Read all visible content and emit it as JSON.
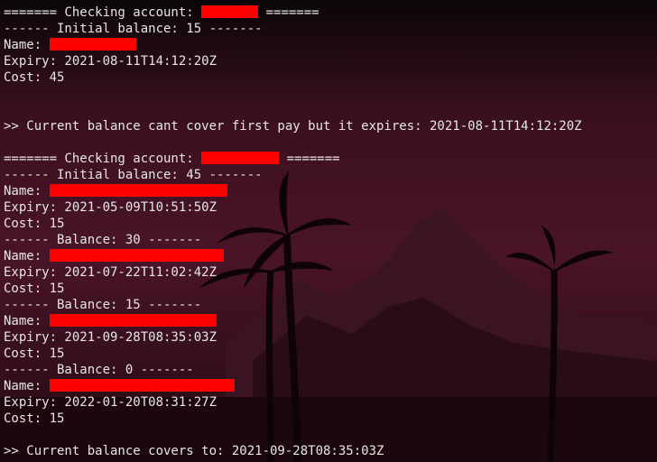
{
  "terminal": {
    "lines": [
      {
        "pre": "======= Checking account: ",
        "redact": "r-acc1",
        "post": " ======="
      },
      {
        "text": "------ Initial balance: 15 -------"
      },
      {
        "pre": "Name: ",
        "redact": "r-name1",
        "post": ""
      },
      {
        "text": "Expiry: 2021-08-11T14:12:20Z"
      },
      {
        "text": "Cost: 45"
      },
      {
        "blank": true
      },
      {
        "blank": true
      },
      {
        "text": ">> Current balance cant cover first pay but it expires: 2021-08-11T14:12:20Z"
      },
      {
        "blank": true
      },
      {
        "pre": "======= Checking account: ",
        "redact": "r-acc2",
        "post": " ======="
      },
      {
        "text": "------ Initial balance: 45 -------"
      },
      {
        "pre": "Name: ",
        "redact": "r-name2",
        "post": ""
      },
      {
        "text": "Expiry: 2021-05-09T10:51:50Z"
      },
      {
        "text": "Cost: 15"
      },
      {
        "text": "------ Balance: 30 -------"
      },
      {
        "pre": "Name: ",
        "redact": "r-name3",
        "post": ""
      },
      {
        "text": "Expiry: 2021-07-22T11:02:42Z"
      },
      {
        "text": "Cost: 15"
      },
      {
        "text": "------ Balance: 15 -------"
      },
      {
        "pre": "Name: ",
        "redact": "r-name4",
        "post": ""
      },
      {
        "text": "Expiry: 2021-09-28T08:35:03Z"
      },
      {
        "text": "Cost: 15"
      },
      {
        "text": "------ Balance: 0 -------"
      },
      {
        "pre": "Name: ",
        "redact": "r-name5",
        "post": ""
      },
      {
        "text": "Expiry: 2022-01-20T08:31:27Z"
      },
      {
        "text": "Cost: 15"
      },
      {
        "blank": true
      },
      {
        "text": ">> Current balance covers to: 2021-09-28T08:35:03Z"
      }
    ]
  },
  "colors": {
    "text": "#e6e6e6",
    "redaction": "#ff0000",
    "background": "#1a0a10"
  }
}
